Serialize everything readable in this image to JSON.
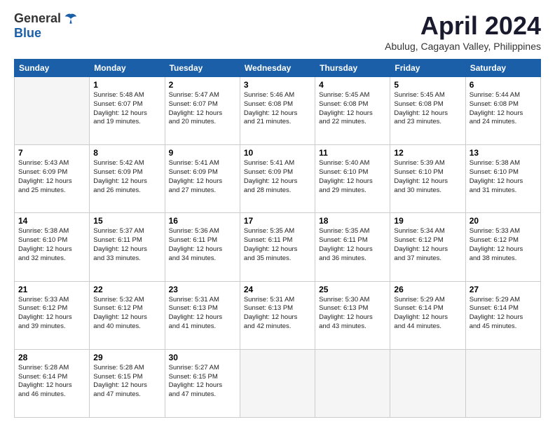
{
  "logo": {
    "general": "General",
    "blue": "Blue"
  },
  "title": "April 2024",
  "location": "Abulug, Cagayan Valley, Philippines",
  "days": [
    "Sunday",
    "Monday",
    "Tuesday",
    "Wednesday",
    "Thursday",
    "Friday",
    "Saturday"
  ],
  "weeks": [
    [
      {
        "day": "",
        "content": ""
      },
      {
        "day": "1",
        "content": "Sunrise: 5:48 AM\nSunset: 6:07 PM\nDaylight: 12 hours\nand 19 minutes."
      },
      {
        "day": "2",
        "content": "Sunrise: 5:47 AM\nSunset: 6:07 PM\nDaylight: 12 hours\nand 20 minutes."
      },
      {
        "day": "3",
        "content": "Sunrise: 5:46 AM\nSunset: 6:08 PM\nDaylight: 12 hours\nand 21 minutes."
      },
      {
        "day": "4",
        "content": "Sunrise: 5:45 AM\nSunset: 6:08 PM\nDaylight: 12 hours\nand 22 minutes."
      },
      {
        "day": "5",
        "content": "Sunrise: 5:45 AM\nSunset: 6:08 PM\nDaylight: 12 hours\nand 23 minutes."
      },
      {
        "day": "6",
        "content": "Sunrise: 5:44 AM\nSunset: 6:08 PM\nDaylight: 12 hours\nand 24 minutes."
      }
    ],
    [
      {
        "day": "7",
        "content": "Sunrise: 5:43 AM\nSunset: 6:09 PM\nDaylight: 12 hours\nand 25 minutes."
      },
      {
        "day": "8",
        "content": "Sunrise: 5:42 AM\nSunset: 6:09 PM\nDaylight: 12 hours\nand 26 minutes."
      },
      {
        "day": "9",
        "content": "Sunrise: 5:41 AM\nSunset: 6:09 PM\nDaylight: 12 hours\nand 27 minutes."
      },
      {
        "day": "10",
        "content": "Sunrise: 5:41 AM\nSunset: 6:09 PM\nDaylight: 12 hours\nand 28 minutes."
      },
      {
        "day": "11",
        "content": "Sunrise: 5:40 AM\nSunset: 6:10 PM\nDaylight: 12 hours\nand 29 minutes."
      },
      {
        "day": "12",
        "content": "Sunrise: 5:39 AM\nSunset: 6:10 PM\nDaylight: 12 hours\nand 30 minutes."
      },
      {
        "day": "13",
        "content": "Sunrise: 5:38 AM\nSunset: 6:10 PM\nDaylight: 12 hours\nand 31 minutes."
      }
    ],
    [
      {
        "day": "14",
        "content": "Sunrise: 5:38 AM\nSunset: 6:10 PM\nDaylight: 12 hours\nand 32 minutes."
      },
      {
        "day": "15",
        "content": "Sunrise: 5:37 AM\nSunset: 6:11 PM\nDaylight: 12 hours\nand 33 minutes."
      },
      {
        "day": "16",
        "content": "Sunrise: 5:36 AM\nSunset: 6:11 PM\nDaylight: 12 hours\nand 34 minutes."
      },
      {
        "day": "17",
        "content": "Sunrise: 5:35 AM\nSunset: 6:11 PM\nDaylight: 12 hours\nand 35 minutes."
      },
      {
        "day": "18",
        "content": "Sunrise: 5:35 AM\nSunset: 6:11 PM\nDaylight: 12 hours\nand 36 minutes."
      },
      {
        "day": "19",
        "content": "Sunrise: 5:34 AM\nSunset: 6:12 PM\nDaylight: 12 hours\nand 37 minutes."
      },
      {
        "day": "20",
        "content": "Sunrise: 5:33 AM\nSunset: 6:12 PM\nDaylight: 12 hours\nand 38 minutes."
      }
    ],
    [
      {
        "day": "21",
        "content": "Sunrise: 5:33 AM\nSunset: 6:12 PM\nDaylight: 12 hours\nand 39 minutes."
      },
      {
        "day": "22",
        "content": "Sunrise: 5:32 AM\nSunset: 6:12 PM\nDaylight: 12 hours\nand 40 minutes."
      },
      {
        "day": "23",
        "content": "Sunrise: 5:31 AM\nSunset: 6:13 PM\nDaylight: 12 hours\nand 41 minutes."
      },
      {
        "day": "24",
        "content": "Sunrise: 5:31 AM\nSunset: 6:13 PM\nDaylight: 12 hours\nand 42 minutes."
      },
      {
        "day": "25",
        "content": "Sunrise: 5:30 AM\nSunset: 6:13 PM\nDaylight: 12 hours\nand 43 minutes."
      },
      {
        "day": "26",
        "content": "Sunrise: 5:29 AM\nSunset: 6:14 PM\nDaylight: 12 hours\nand 44 minutes."
      },
      {
        "day": "27",
        "content": "Sunrise: 5:29 AM\nSunset: 6:14 PM\nDaylight: 12 hours\nand 45 minutes."
      }
    ],
    [
      {
        "day": "28",
        "content": "Sunrise: 5:28 AM\nSunset: 6:14 PM\nDaylight: 12 hours\nand 46 minutes."
      },
      {
        "day": "29",
        "content": "Sunrise: 5:28 AM\nSunset: 6:15 PM\nDaylight: 12 hours\nand 47 minutes."
      },
      {
        "day": "30",
        "content": "Sunrise: 5:27 AM\nSunset: 6:15 PM\nDaylight: 12 hours\nand 47 minutes."
      },
      {
        "day": "",
        "content": ""
      },
      {
        "day": "",
        "content": ""
      },
      {
        "day": "",
        "content": ""
      },
      {
        "day": "",
        "content": ""
      }
    ]
  ]
}
